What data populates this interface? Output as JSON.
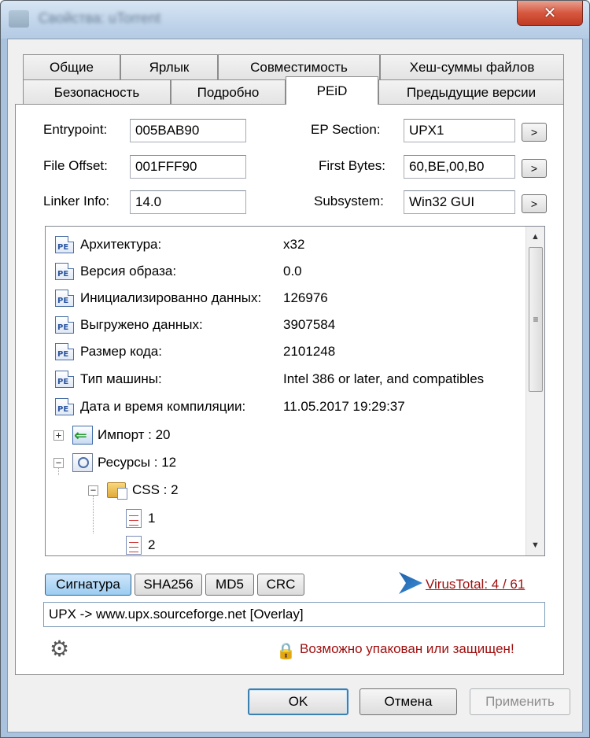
{
  "window": {
    "title": "Свойства: uTorrent",
    "close_label": "✕"
  },
  "tabs": {
    "row1": [
      "Общие",
      "Ярлык",
      "Совместимость",
      "Хеш-суммы файлов"
    ],
    "row2": [
      "Безопасность",
      "Подробно",
      "PEiD",
      "Предыдущие версии"
    ],
    "active": "PEiD"
  },
  "info": {
    "entrypoint_label": "Entrypoint:",
    "entrypoint_value": "005BAB90",
    "file_offset_label": "File Offset:",
    "file_offset_value": "001FFF90",
    "linker_label": "Linker Info:",
    "linker_value": "14.0",
    "ep_section_label": "EP Section:",
    "ep_section_value": "UPX1",
    "first_bytes_label": "First Bytes:",
    "first_bytes_value": "60,BE,00,B0",
    "subsystem_label": "Subsystem:",
    "subsystem_value": "Win32 GUI",
    "more_button": ">"
  },
  "tree": {
    "pe_icon_text": "PE",
    "props": [
      {
        "name": "Архитектура:",
        "value": "x32"
      },
      {
        "name": "Версия образа:",
        "value": "0.0"
      },
      {
        "name": "Инициализированно данных:",
        "value": "126976"
      },
      {
        "name": "Выгружено данных:",
        "value": "3907584"
      },
      {
        "name": "Размер кода:",
        "value": "2101248"
      },
      {
        "name": "Тип машины:",
        "value": "Intel 386 or later, and compatibles"
      },
      {
        "name": "Дата и время компиляции:",
        "value": "11.05.2017 19:29:37"
      }
    ],
    "import_label": "Импорт : 20",
    "import_expander": "+",
    "resources_label": "Ресурсы : 12",
    "resources_expander": "−",
    "css_label": "CSS : 2",
    "css_expander": "−",
    "css_items": [
      "1",
      "2"
    ]
  },
  "scrollbar": {
    "up": "▲",
    "down": "▼",
    "grip": "≡"
  },
  "hash_buttons": [
    "Сигнатура",
    "SHA256",
    "MD5",
    "CRC"
  ],
  "virustotal": {
    "label": "VirusTotal: 4 / 61"
  },
  "signature": {
    "value": "UPX -> www.upx.sourceforge.net [Overlay]"
  },
  "status": {
    "warning": "Возможно упакован или защищен!"
  },
  "dialog_buttons": {
    "ok": "OK",
    "cancel": "Отмена",
    "apply": "Применить"
  },
  "colors": {
    "warning_red": "#a01010",
    "active_button": "#9ccdf1"
  }
}
